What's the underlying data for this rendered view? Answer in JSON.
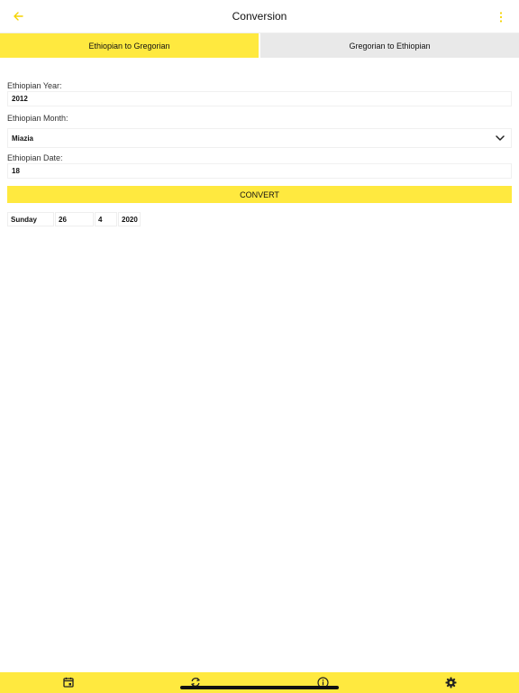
{
  "header": {
    "title": "Conversion",
    "back_icon": "arrow-left-icon",
    "menu_icon": "more-vertical-icon",
    "accent": "#ffe93f"
  },
  "tabs": [
    {
      "label": "Ethiopian to Gregorian",
      "active": true
    },
    {
      "label": "Gregorian to Ethiopian",
      "active": false
    }
  ],
  "form": {
    "year_label": "Ethiopian Year:",
    "year_value": "2012",
    "month_label": "Ethiopian Month:",
    "month_value": "Miazia",
    "date_label": "Ethiopian Date:",
    "date_value": "18",
    "convert_label": "CONVERT"
  },
  "result": {
    "weekday": "Sunday",
    "day": "26",
    "month": "4",
    "year": "2020"
  },
  "bottom_nav": [
    {
      "icon": "calendar-icon"
    },
    {
      "icon": "sync-icon"
    },
    {
      "icon": "info-icon"
    },
    {
      "icon": "settings-icon"
    }
  ]
}
